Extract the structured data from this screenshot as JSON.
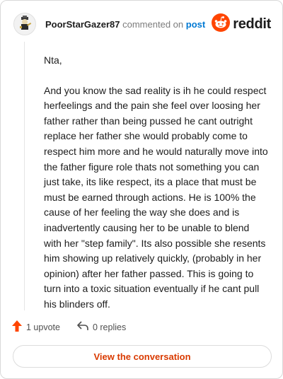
{
  "header": {
    "username": "PoorStarGazer87",
    "action_text": "commented on",
    "post_link": "post",
    "logo_text": "reddit",
    "avatar_icon": "stargazer-avatar-icon"
  },
  "comment": {
    "greeting": "Nta,",
    "body": "And you know the sad reality is ih he could respect herfeelings and the pain she feel over loosing her father rather than being pussed he cant outright replace her father she would probably come to respect him more and he would naturally move into the father figure role thats not something you can just take, its like respect, its a place that must be must be earned through actions. He is 100% the cause of her feeling the way she does and is inadvertently causing her to be unable to blend with her \"step family\". Its also possible she resents him showing up relatively quickly, (probably in her opinion) after her father passed. This is going to turn into a toxic situation eventually if he cant pull his blinders off."
  },
  "footer": {
    "upvote_label": "1 upvote",
    "replies_label": "0 replies"
  },
  "view_button": "View the conversation",
  "colors": {
    "upvote": "#ff4500",
    "link": "#0079d3",
    "button_text": "#d93a00",
    "logo": "#ff4500"
  }
}
